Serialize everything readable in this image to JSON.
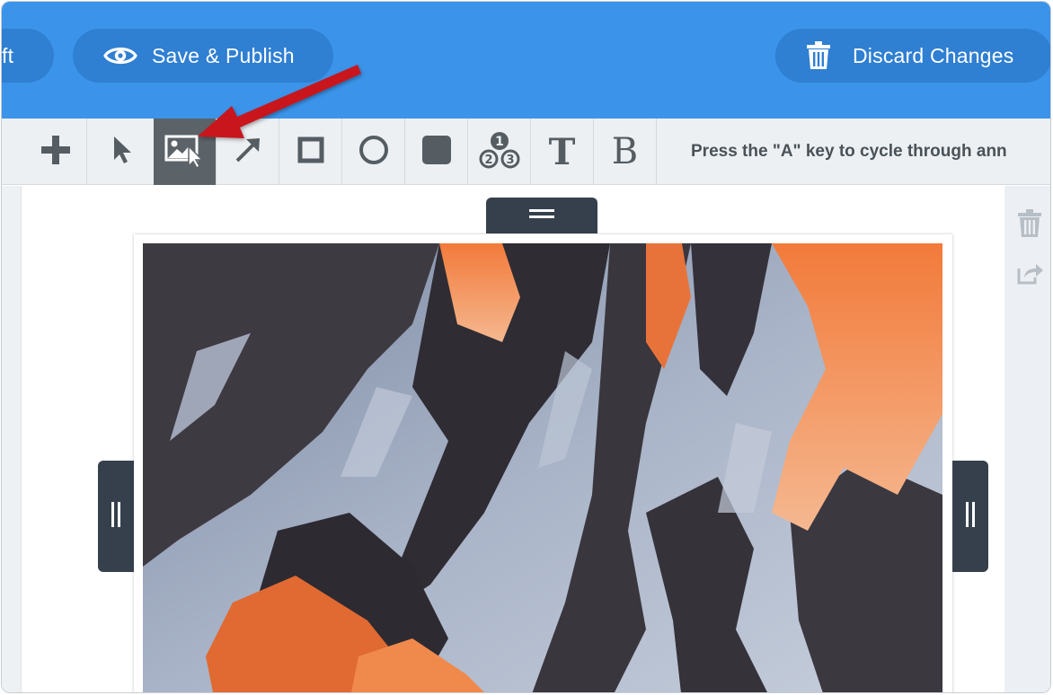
{
  "header": {
    "draft_label": "ft",
    "save_label": "Save & Publish",
    "discard_label": "Discard Changes"
  },
  "toolbar": {
    "tools": [
      {
        "name": "add",
        "label": ""
      },
      {
        "name": "select",
        "label": ""
      },
      {
        "name": "image-select",
        "label": "",
        "active": true
      },
      {
        "name": "arrow",
        "label": ""
      },
      {
        "name": "rectangle",
        "label": ""
      },
      {
        "name": "circle",
        "label": ""
      },
      {
        "name": "filled-rectangle",
        "label": ""
      },
      {
        "name": "numbered-steps",
        "label": ""
      },
      {
        "name": "text",
        "label": "T"
      },
      {
        "name": "bold-text",
        "label": "B"
      }
    ],
    "hint": "Press the \"A\" key to cycle through ann"
  },
  "colors": {
    "header_blue": "#3b94ea",
    "pill_blue": "#2f7fd2",
    "toolbar_bg": "#ecf0f3",
    "active_tool": "#5b6369",
    "handle_dark": "#35404c",
    "annotation_red": "#c8151b"
  },
  "icons": {
    "save": "eye-icon",
    "discard": "trash-icon",
    "right_panel": [
      "trash-icon",
      "share-icon"
    ]
  }
}
